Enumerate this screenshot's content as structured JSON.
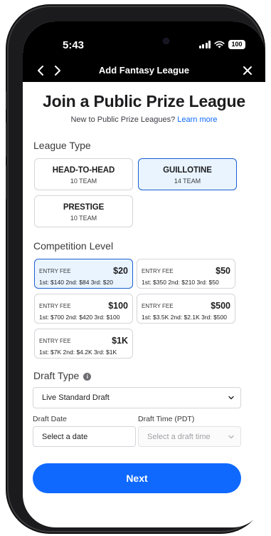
{
  "status_bar": {
    "time": "5:43",
    "battery": "100"
  },
  "nav": {
    "title": "Add Fantasy League"
  },
  "page": {
    "heading": "Join a Public Prize League",
    "subtext": "New to Public Prize Leagues?",
    "learn_more": "Learn more"
  },
  "league_type": {
    "label": "League Type",
    "options": [
      {
        "name": "HEAD-TO-HEAD",
        "teams": "10 TEAM",
        "selected": false
      },
      {
        "name": "GUILLOTINE",
        "teams": "14 TEAM",
        "selected": true
      },
      {
        "name": "PRESTIGE",
        "teams": "10 TEAM",
        "selected": false
      }
    ]
  },
  "competition_level": {
    "label": "Competition Level",
    "options": [
      {
        "entry_label": "ENTRY FEE",
        "amount": "$20",
        "payout": "1st: $140 2nd: $84 3rd: $20",
        "selected": true
      },
      {
        "entry_label": "ENTRY FEE",
        "amount": "$50",
        "payout": "1st: $350 2nd: $210 3rd: $50",
        "selected": false
      },
      {
        "entry_label": "ENTRY FEE",
        "amount": "$100",
        "payout": "1st: $700 2nd: $420 3rd: $100",
        "selected": false
      },
      {
        "entry_label": "ENTRY FEE",
        "amount": "$500",
        "payout": "1st: $3.5K 2nd: $2.1K 3rd: $500",
        "selected": false
      },
      {
        "entry_label": "ENTRY FEE",
        "amount": "$1K",
        "payout": "1st: $7K 2nd: $4.2K 3rd: $1K",
        "selected": false
      }
    ]
  },
  "draft_type": {
    "label": "Draft Type",
    "value": "Live Standard Draft"
  },
  "draft_date": {
    "label": "Draft Date",
    "placeholder": "Select a date"
  },
  "draft_time": {
    "label": "Draft Time (PDT)",
    "placeholder": "Select a draft time"
  },
  "next_button": "Next",
  "colors": {
    "accent": "#0f69ff",
    "selected_bg": "#e9f4ff",
    "selected_border": "#1a5fd0"
  }
}
